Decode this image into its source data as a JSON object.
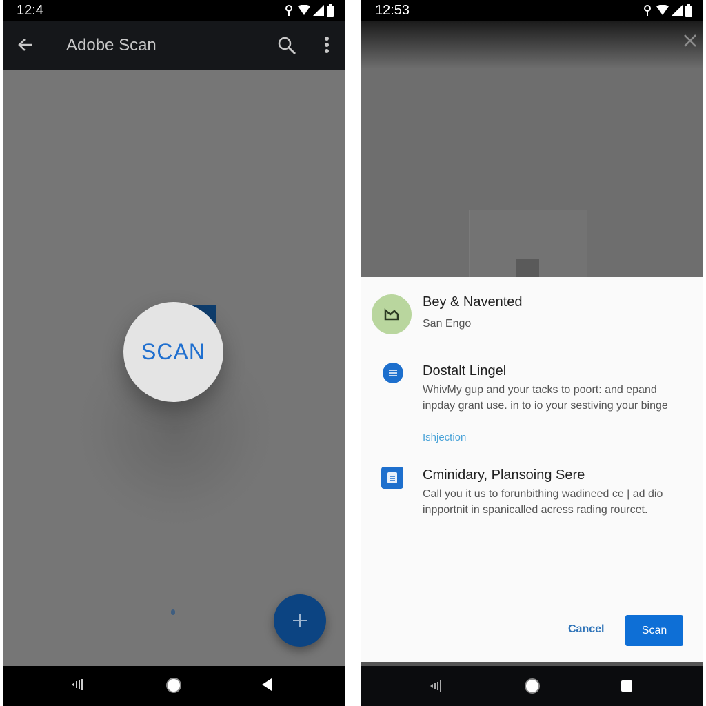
{
  "left_screen": {
    "status_bar": {
      "time": "12:4"
    },
    "app_bar": {
      "title": "Adobe Scan"
    },
    "scan_button_label": "SCAN",
    "fab_label": "+",
    "colors": {
      "fab": "#0c4482",
      "scan_text": "#1f6fcf"
    }
  },
  "right_screen": {
    "status_bar": {
      "time": "12:53"
    },
    "sheet": {
      "items": [
        {
          "title": "Bey & Navented",
          "subtitle": "San Engo"
        },
        {
          "title": "Dostalt Lingel",
          "body": "WhivMy gup and your tacks to poort: and epand inpday grant use. in to io your sestiving your binge",
          "link": "Ishjection"
        },
        {
          "title": "Cminidary, Plansoing Sere",
          "body": "Call you it us to forunbithing wadineed ce | ad dio inpportnit in spanicalled acress rading rourcet."
        }
      ],
      "cancel_label": "Cancel",
      "scan_label": "Scan"
    },
    "colors": {
      "primary": "#0e6fd6",
      "avatar": "#b9d69e"
    }
  }
}
